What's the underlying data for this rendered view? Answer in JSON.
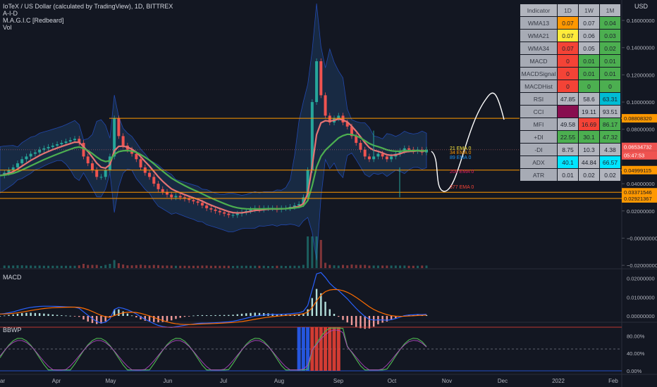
{
  "legend": {
    "symbol": "IoTeX / US Dollar (calculated by TradingView), 1D, BITTREX",
    "lines": [
      "A-I-D",
      "M.A.G.I.C [Redbeard]",
      "Vol"
    ]
  },
  "currency": "USD",
  "colors": {
    "bg": "#131722",
    "up": "#26a69a",
    "down": "#ef5350",
    "bb_fill": "#1e3a5f",
    "orange": "#ff9800",
    "green_ema": "#4caf50",
    "pink_ema": "#e57373",
    "grid": "#1e222d"
  },
  "chart_data": [
    {
      "type": "line",
      "pane": "price",
      "x_ticks": [
        "ar",
        "Apr",
        "May",
        "Jun",
        "Jul",
        "Aug",
        "Sep",
        "Oct",
        "Nov",
        "Dec",
        "2022",
        "Feb"
      ],
      "y_ticks": [
        "0.16000000",
        "0.14000000",
        "0.12000000",
        "0.10000000",
        "0.08000000",
        "0.06000000",
        "0.04000000",
        "0.02000000",
        "−0.00000000",
        "−0.02000000"
      ],
      "ylim": [
        -0.022,
        0.175
      ],
      "price_labels": [
        "0.08808320",
        "0.06534732",
        "05:47:53",
        "0.04999115",
        "0.03371546",
        "0.02921367"
      ],
      "horizontal_levels": [
        0.0880832,
        0.04999115,
        0.03371546,
        0.02921367
      ],
      "ema_labels": [
        "21 EMA 0",
        "34 EMA 0",
        "89 EMA 0",
        "200 EMA 0",
        "377 EMA 0"
      ],
      "close_series": [
        0.046,
        0.048,
        0.05,
        0.052,
        0.055,
        0.058,
        0.06,
        0.062,
        0.063,
        0.065,
        0.066,
        0.067,
        0.068,
        0.069,
        0.07,
        0.071,
        0.072,
        0.073,
        0.07,
        0.06,
        0.055,
        0.05,
        0.045,
        0.045,
        0.05,
        0.06,
        0.088,
        0.075,
        0.068,
        0.065,
        0.062,
        0.058,
        0.052,
        0.048,
        0.045,
        0.04,
        0.036,
        0.034,
        0.032,
        0.03,
        0.031,
        0.03,
        0.029,
        0.028,
        0.027,
        0.026,
        0.024,
        0.022,
        0.021,
        0.02,
        0.019,
        0.018,
        0.017,
        0.017,
        0.018,
        0.019,
        0.02,
        0.021,
        0.022,
        0.021,
        0.022,
        0.022,
        0.022,
        0.021,
        0.022,
        0.022,
        0.023,
        0.024,
        0.025,
        0.03,
        0.05,
        0.1,
        0.13,
        0.105,
        0.09,
        0.085,
        0.088,
        0.09,
        0.085,
        0.082,
        0.075,
        0.07,
        0.065,
        0.06,
        0.058,
        0.06,
        0.062,
        0.06,
        0.058,
        0.06,
        0.062,
        0.064,
        0.066,
        0.065,
        0.064,
        0.065,
        0.063,
        0.065
      ]
    },
    {
      "type": "bar",
      "pane": "MACD",
      "title": "MACD",
      "y_ticks": [
        "0.02000000",
        "0.01000000",
        "0.00000000"
      ],
      "ylim": [
        -0.003,
        0.024
      ]
    },
    {
      "type": "line",
      "pane": "BBWP",
      "title": "BBWP",
      "y_ticks": [
        "80.00%",
        "40.00%",
        "0.00%"
      ],
      "ylim": [
        0,
        100
      ],
      "levels": [
        100,
        50,
        0
      ]
    }
  ],
  "table": {
    "headers": [
      "Indicator",
      "1D",
      "1W",
      "1M"
    ],
    "rows": [
      {
        "name": "WMA13",
        "cells": [
          {
            "v": "0.07",
            "c": "#ff9800"
          },
          {
            "v": "0.07",
            "c": "#b2b5be"
          },
          {
            "v": "0.04",
            "c": "#4caf50"
          }
        ]
      },
      {
        "name": "WMA21",
        "cells": [
          {
            "v": "0.07",
            "c": "#ffeb3b"
          },
          {
            "v": "0.06",
            "c": "#b2b5be"
          },
          {
            "v": "0.03",
            "c": "#4caf50"
          }
        ]
      },
      {
        "name": "WMA34",
        "cells": [
          {
            "v": "0.07",
            "c": "#f44336"
          },
          {
            "v": "0.05",
            "c": "#b2b5be"
          },
          {
            "v": "0.02",
            "c": "#4caf50"
          }
        ]
      },
      {
        "name": "MACD",
        "cells": [
          {
            "v": "0",
            "c": "#f44336"
          },
          {
            "v": "0.01",
            "c": "#4caf50"
          },
          {
            "v": "0.01",
            "c": "#4caf50"
          }
        ]
      },
      {
        "name": "MACDSignal",
        "cells": [
          {
            "v": "0",
            "c": "#f44336"
          },
          {
            "v": "0.01",
            "c": "#4caf50"
          },
          {
            "v": "0.01",
            "c": "#4caf50"
          }
        ]
      },
      {
        "name": "MACDHist",
        "cells": [
          {
            "v": "0",
            "c": "#f44336"
          },
          {
            "v": "0",
            "c": "#4caf50"
          },
          {
            "v": "0",
            "c": "#4caf50"
          }
        ]
      },
      {
        "name": "RSI",
        "cells": [
          {
            "v": "47.85",
            "c": "#b2b5be"
          },
          {
            "v": "58.6",
            "c": "#b2b5be"
          },
          {
            "v": "63.31",
            "c": "#00bcd4"
          }
        ]
      },
      {
        "name": "CCI",
        "cells": [
          {
            "v": "",
            "c": "#880e4f"
          },
          {
            "v": "19.11",
            "c": "#b2b5be"
          },
          {
            "v": "93.51",
            "c": "#b2b5be"
          }
        ]
      },
      {
        "name": "MFI",
        "cells": [
          {
            "v": "49.58",
            "c": "#b2b5be"
          },
          {
            "v": "16.69",
            "c": "#f44336"
          },
          {
            "v": "86.17",
            "c": "#4caf50"
          }
        ]
      },
      {
        "name": "+DI",
        "cells": [
          {
            "v": "22.55",
            "c": "#4caf50"
          },
          {
            "v": "30.1",
            "c": "#4caf50"
          },
          {
            "v": "47.32",
            "c": "#4caf50"
          }
        ]
      },
      {
        "name": "-DI",
        "cells": [
          {
            "v": "8.75",
            "c": "#b2b5be"
          },
          {
            "v": "10.3",
            "c": "#b2b5be"
          },
          {
            "v": "4.38",
            "c": "#b2b5be"
          }
        ]
      },
      {
        "name": "ADX",
        "cells": [
          {
            "v": "40.1",
            "c": "#00e5ff"
          },
          {
            "v": "44.84",
            "c": "#b2b5be"
          },
          {
            "v": "66.57",
            "c": "#00e5ff"
          }
        ]
      },
      {
        "name": "ATR",
        "cells": [
          {
            "v": "0.01",
            "c": "#b2b5be"
          },
          {
            "v": "0.02",
            "c": "#b2b5be"
          },
          {
            "v": "0.02",
            "c": "#b2b5be"
          }
        ]
      }
    ]
  }
}
